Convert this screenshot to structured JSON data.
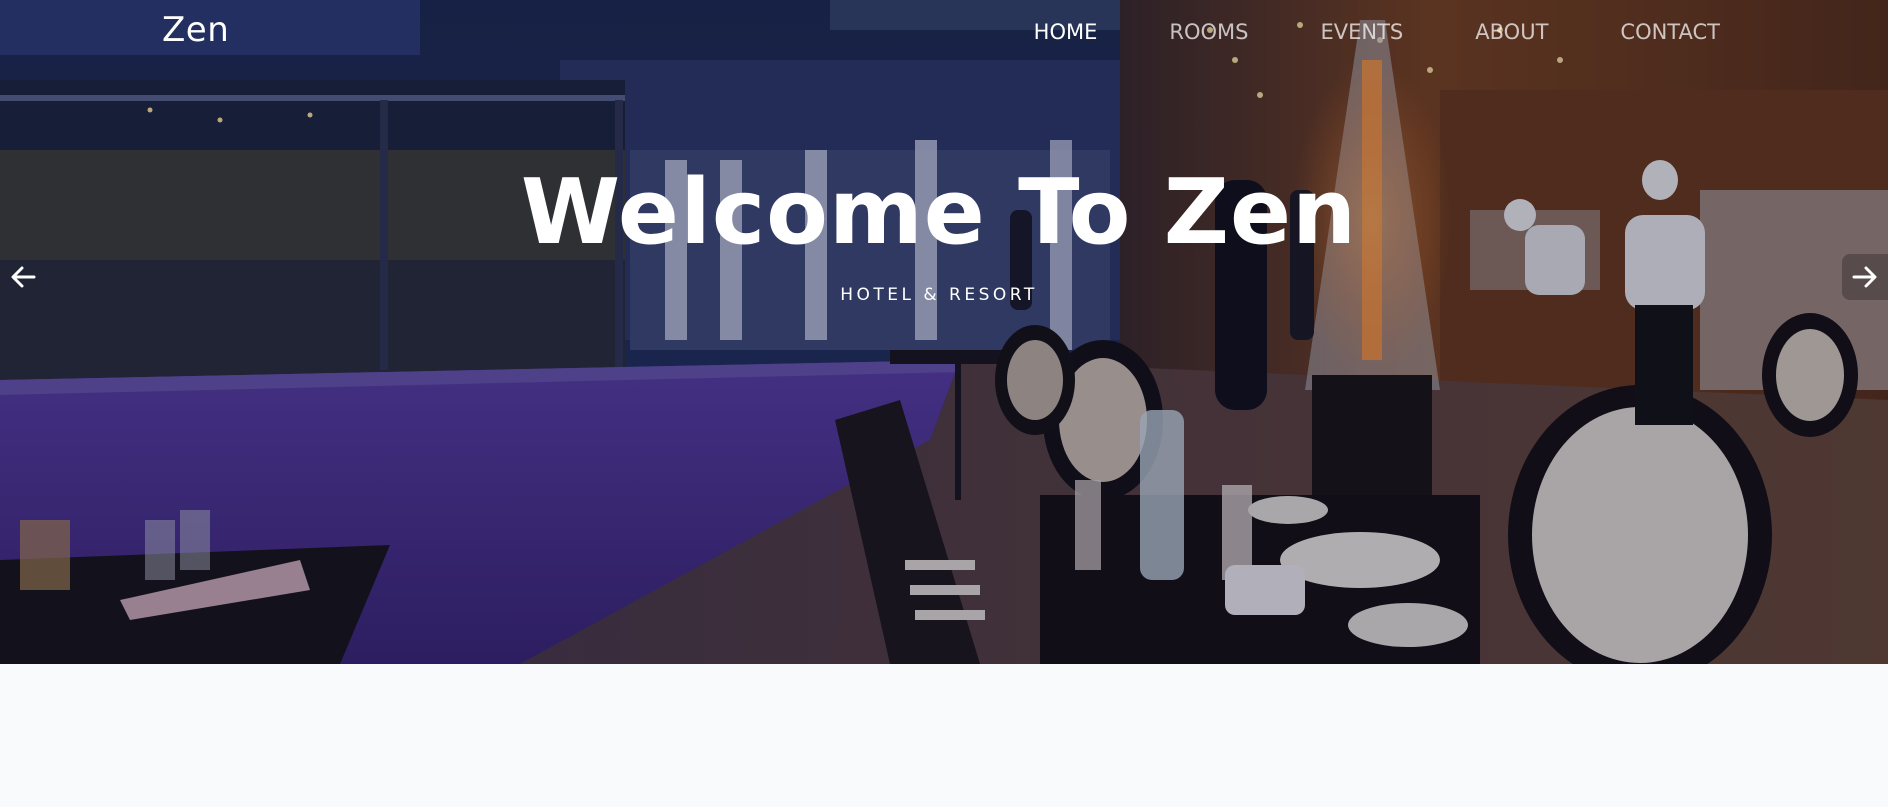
{
  "brand": {
    "name": "Zen"
  },
  "nav": {
    "items": [
      {
        "label": "HOME",
        "active": true
      },
      {
        "label": "ROOMS",
        "active": false
      },
      {
        "label": "EVENTS",
        "active": false
      },
      {
        "label": "ABOUT",
        "active": false
      },
      {
        "label": "CONTACT",
        "active": false
      }
    ]
  },
  "hero": {
    "title": "Welcome To Zen",
    "subtitle": "HOTEL & RESORT",
    "prev_icon": "arrow-left-icon",
    "next_icon": "arrow-right-icon"
  },
  "colors": {
    "text": "#ffffff",
    "page_background": "#f9fafb",
    "pool": "#4a2f8f",
    "restaurant_warm": "#8a4a22"
  }
}
